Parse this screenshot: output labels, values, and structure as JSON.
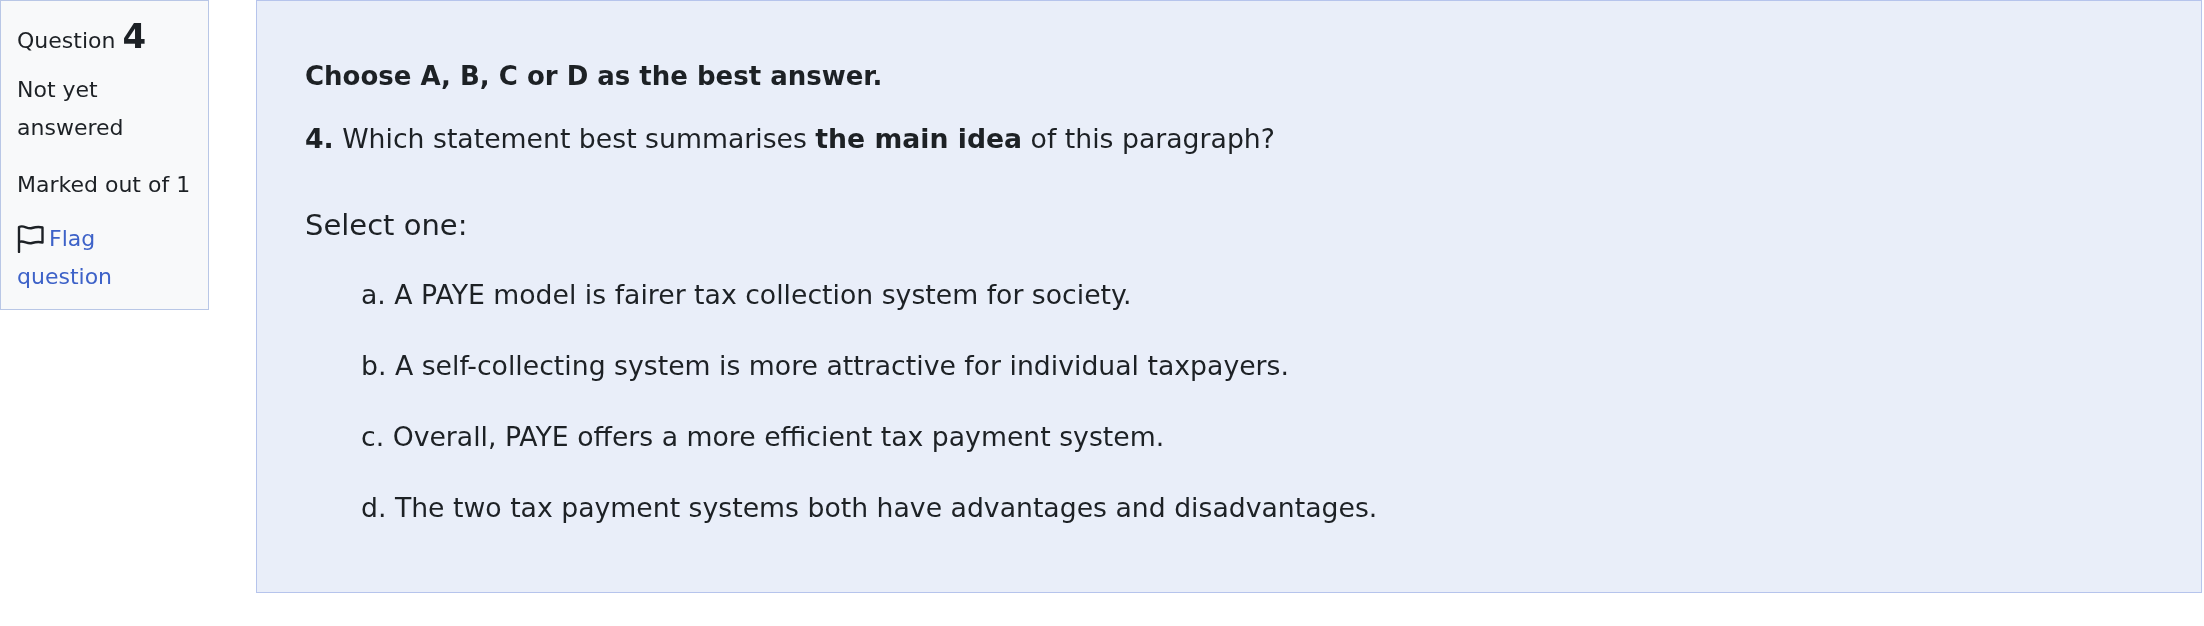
{
  "info": {
    "label": "Question",
    "number": "4",
    "status": "Not yet answered",
    "marks": "Marked out of 1",
    "flag": "Flag question"
  },
  "question": {
    "instruction": "Choose A, B, C or D as the best answer.",
    "text": "**4.** Which statement best summarises **the main idea** of this paragraph?",
    "prompt": "Select one:",
    "options": [
      "a. A PAYE model is fairer tax collection system for society.",
      "b. A self-collecting system is more attractive for individual taxpayers.",
      "c. Overall, PAYE offers a more efficient tax payment system.",
      "d. The two tax payment systems both have advantages and disadvantages."
    ]
  }
}
